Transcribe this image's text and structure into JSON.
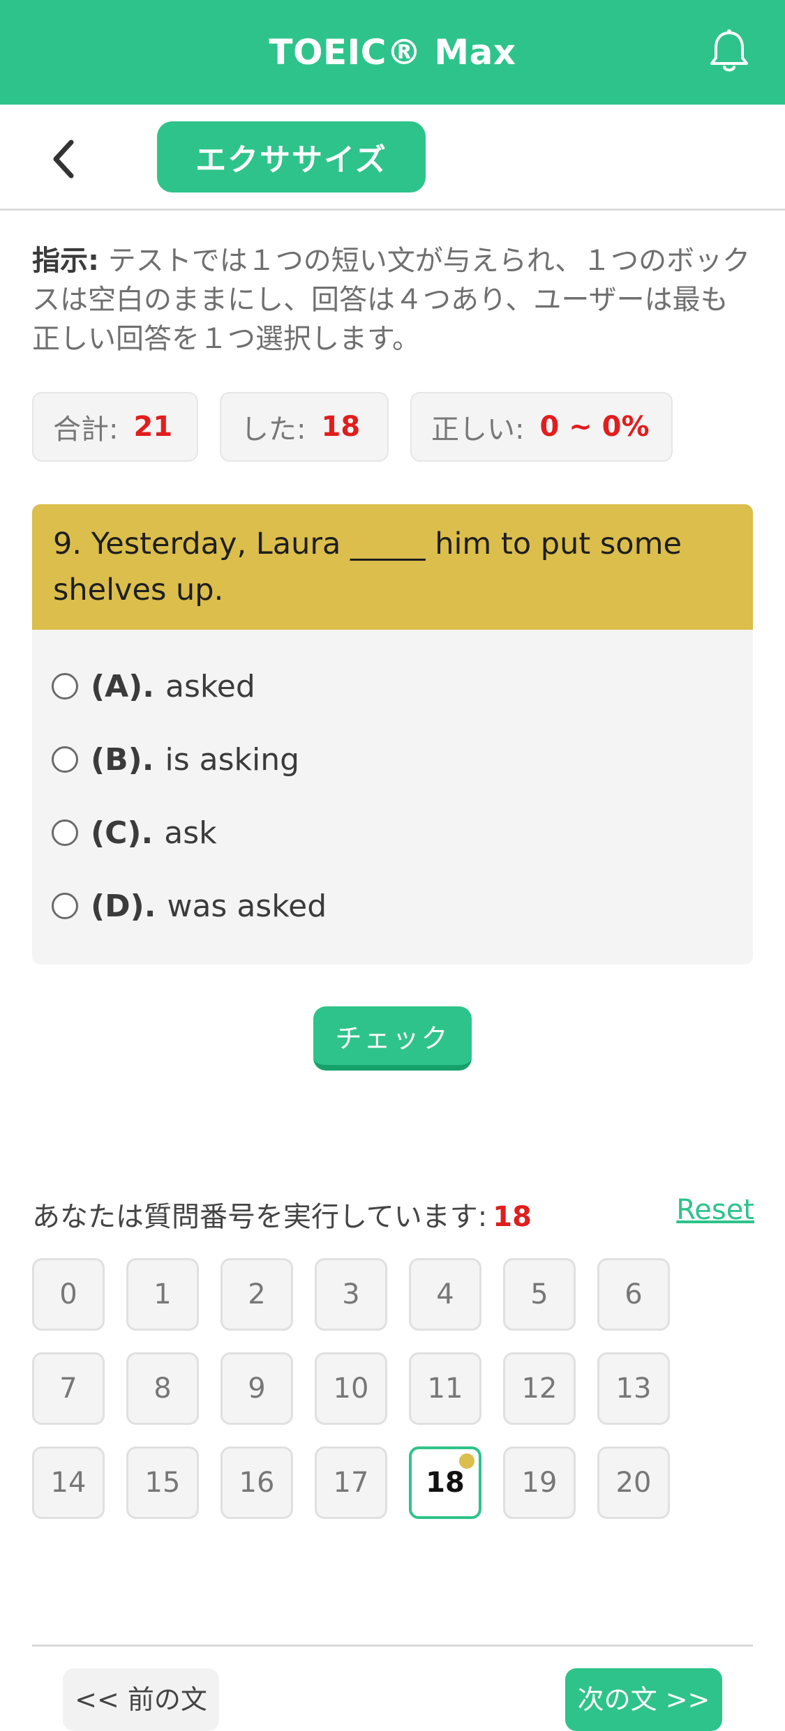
{
  "header": {
    "title": "TOEIC® Max",
    "notification_icon": "bell-icon"
  },
  "subheader": {
    "back_icon": "chevron-left-icon",
    "tab_label": "エクササイズ"
  },
  "instructions": {
    "label": "指示:",
    "text": " テストでは１つの短い文が与えられ、１つのボックスは空白のままにし、回答は４つあり、ユーザーは最も正しい回答を１つ選択します。"
  },
  "stats": {
    "total_label": "合計:",
    "total_value": "21",
    "done_label": "した:",
    "done_value": "18",
    "correct_label": "正しい:",
    "correct_value": "0 ~ 0%"
  },
  "question": {
    "text": "9. Yesterday, Laura _____ him to put some shelves up.",
    "options": [
      {
        "letter": "(A).",
        "text": "asked"
      },
      {
        "letter": "(B).",
        "text": "is asking"
      },
      {
        "letter": "(C).",
        "text": "ask"
      },
      {
        "letter": "(D).",
        "text": "was asked"
      }
    ]
  },
  "check_button": "チェック",
  "progress": {
    "label": "あなたは質問番号を実行しています:",
    "current": "18",
    "reset": "Reset"
  },
  "question_numbers": [
    "0",
    "1",
    "2",
    "3",
    "4",
    "5",
    "6",
    "7",
    "8",
    "9",
    "10",
    "11",
    "12",
    "13",
    "14",
    "15",
    "16",
    "17",
    "18",
    "19",
    "20"
  ],
  "active_question": "18",
  "nav": {
    "prev": "<< 前の文",
    "next": "次の文 >>"
  },
  "colors": {
    "primary": "#2ec38a",
    "question_header": "#dbbe4c",
    "highlight_red": "#e11d1d"
  }
}
